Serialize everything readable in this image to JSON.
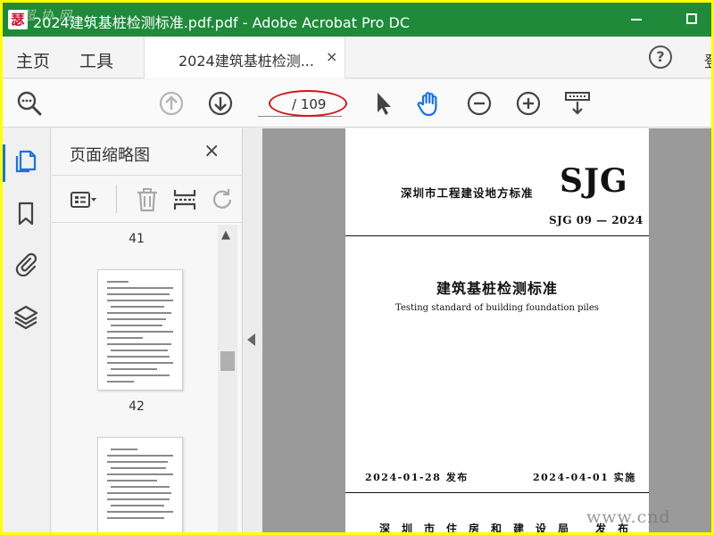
{
  "window": {
    "title": "2024建筑基桩检测标准.pdf.pdf - Adobe Acrobat Pro DC",
    "app_icon_glyph": "瑟",
    "watermark_top": "超 协 网"
  },
  "menu": {
    "home": "主页",
    "tools": "工具",
    "doc_tab": "2024建筑基桩检测...",
    "tab_close": "×",
    "help": "?",
    "overflow": "登"
  },
  "toolbar": {
    "page_indicator": "/ 109",
    "icons": [
      "zoom-search-icon",
      "prev-page-icon",
      "next-page-icon",
      "select-pointer-icon",
      "hand-tool-icon",
      "zoom-out-icon",
      "zoom-in-icon",
      "page-fit-icon"
    ]
  },
  "thumbnails": {
    "panel_title": "页面缩略图",
    "close": "×",
    "page_numbers": [
      "41",
      "42"
    ]
  },
  "document": {
    "standard_label": "深圳市工程建设地方标准",
    "logo": "SJG",
    "code": "SJG 09 — 2024",
    "title_cn": "建筑基桩检测标准",
    "title_en": "Testing standard of building foundation piles",
    "release_date": "2024-01-28  发布",
    "effective_date": "2024-04-01  实施",
    "issuer": "深圳市住房和建设局  发布"
  },
  "watermark": "www.cnd",
  "colors": {
    "titlebar": "#1e8a3a",
    "accent_blue": "#1473e6",
    "annotation_red": "#d01818",
    "border_yellow": "#ffff00"
  }
}
